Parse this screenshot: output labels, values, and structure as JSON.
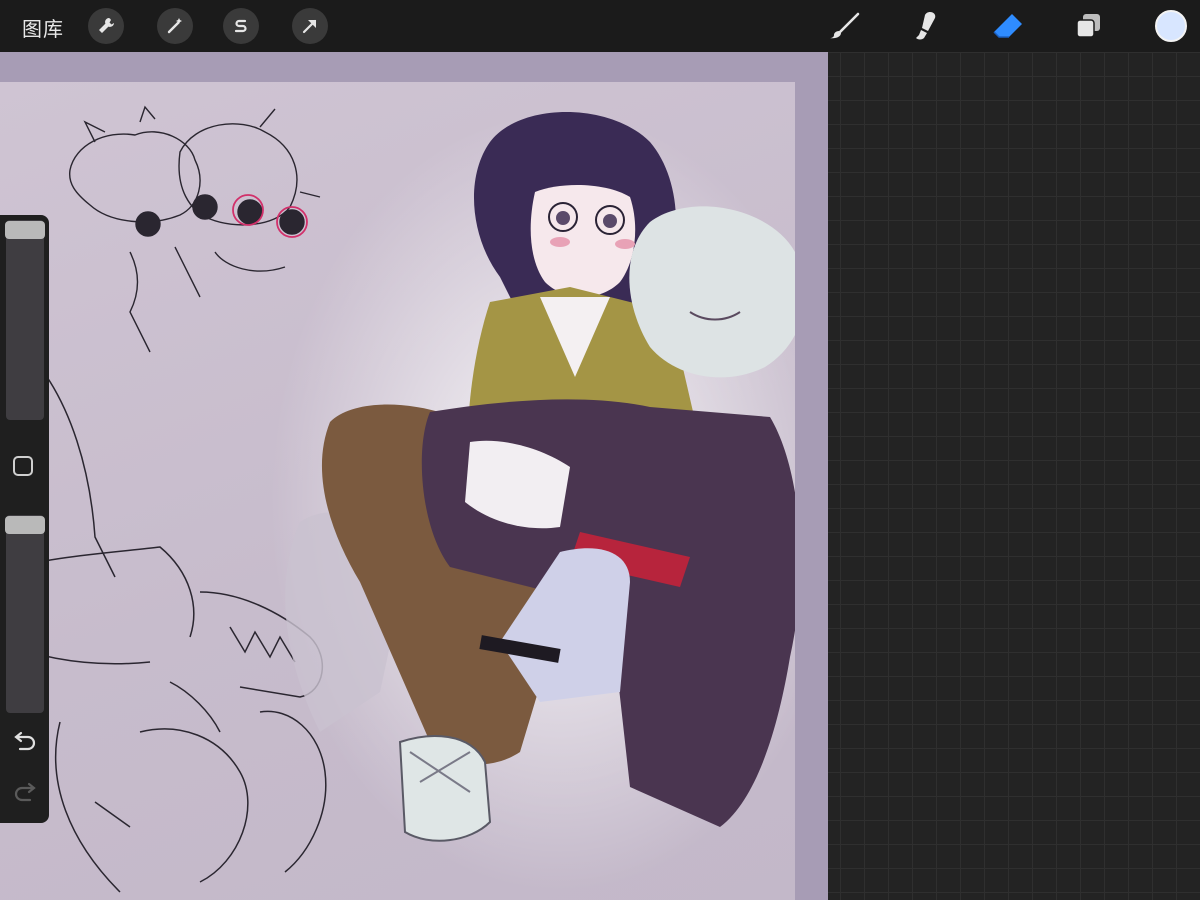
{
  "topbar": {
    "gallery_label": "图库",
    "actions": [
      {
        "name": "actions-wrench-icon"
      },
      {
        "name": "adjustments-wand-icon"
      },
      {
        "name": "selection-s-icon"
      },
      {
        "name": "transform-arrow-icon"
      }
    ],
    "tools": [
      {
        "name": "brush-icon"
      },
      {
        "name": "smudge-icon"
      },
      {
        "name": "eraser-icon",
        "active": true
      },
      {
        "name": "layers-icon"
      }
    ],
    "current_color": "#d8e6ff"
  },
  "sidebar": {
    "brush_size_slider": "brush-size",
    "opacity_slider": "opacity",
    "modify_button": "modify",
    "undo": "undo",
    "redo": "redo"
  },
  "colors": {
    "accent_active_tool": "#2f8cff",
    "toolbar_bg": "#1b1b1b",
    "canvas_bg": "#c8bdcd"
  }
}
